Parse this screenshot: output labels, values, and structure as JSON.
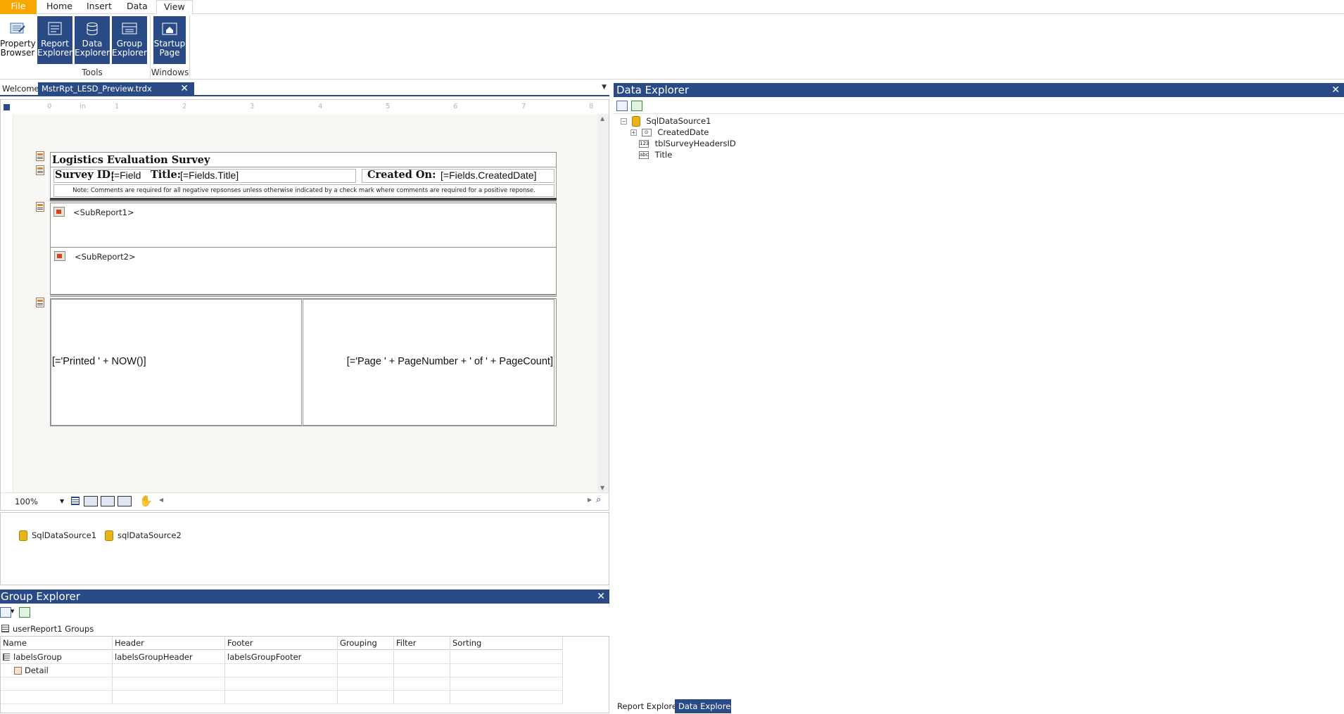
{
  "menu": {
    "file": "File",
    "tabs": [
      "Home",
      "Insert",
      "Data",
      "View"
    ]
  },
  "ribbon": {
    "buttons": [
      {
        "label1": "Property",
        "label2": "Browser",
        "icon": "property-browser-icon"
      },
      {
        "label1": "Report",
        "label2": "Explorer",
        "icon": "report-explorer-icon"
      },
      {
        "label1": "Data",
        "label2": "Explorer",
        "icon": "data-explorer-icon"
      },
      {
        "label1": "Group",
        "label2": "Explorer",
        "icon": "group-explorer-icon"
      },
      {
        "label1": "Startup",
        "label2": "Page",
        "icon": "startup-page-icon"
      }
    ],
    "groups": {
      "tools": "Tools",
      "windows": "Windows"
    }
  },
  "doc_tabs": {
    "welcome": "Welcome",
    "active": "MstrRpt_LESD_Preview.trdx [Design]*"
  },
  "ruler": {
    "unit": "in",
    "marks": [
      "0",
      "1",
      "2",
      "3",
      "4",
      "5",
      "6",
      "7",
      "8"
    ]
  },
  "report": {
    "title": "Logistics Evaluation Survey",
    "survey_id_label": "Survey ID:",
    "survey_id_field": "[=Field",
    "title_label": "Title:",
    "title_field": "[=Fields.Title]",
    "created_on_label": "Created On:",
    "created_on_field": "[=Fields.CreatedDate]",
    "note": "Note: Comments are required for all negative repsonses unless otherwise indicated by a check mark where comments are required for a positive reponse.",
    "subreport1": "<SubReport1>",
    "subreport2": "<SubReport2>",
    "printed": "[='Printed ' + NOW()]",
    "page": "[='Page ' + PageNumber + ' of ' + PageCount]"
  },
  "zoom": {
    "value": "100%"
  },
  "tray": {
    "sources": [
      "SqlDataSource1",
      "sqlDataSource2"
    ]
  },
  "group_explorer": {
    "title": "Group Explorer",
    "groups_label": "userReport1 Groups",
    "columns": [
      "Name",
      "Header",
      "Footer",
      "Grouping",
      "Filter",
      "Sorting"
    ],
    "rows": [
      {
        "name": "labelsGroup",
        "header": "labelsGroupHeader",
        "footer": "labelsGroupFooter"
      },
      {
        "name": "Detail",
        "header": "",
        "footer": ""
      }
    ]
  },
  "data_explorer": {
    "title": "Data Explorer",
    "source": "SqlDataSource1",
    "fields": [
      {
        "name": "CreatedDate",
        "type_badge": "⊙"
      },
      {
        "name": "tblSurveyHeadersID",
        "type_badge": "123"
      },
      {
        "name": "Title",
        "type_badge": "abc"
      }
    ]
  },
  "bottom_tabs": {
    "report_explorer": "Report Explorer",
    "data_explorer": "Data Explorer"
  },
  "colors": {
    "accent": "#2a4a86",
    "file_tab": "#f7a700",
    "canvas": "#f8f7f3"
  }
}
